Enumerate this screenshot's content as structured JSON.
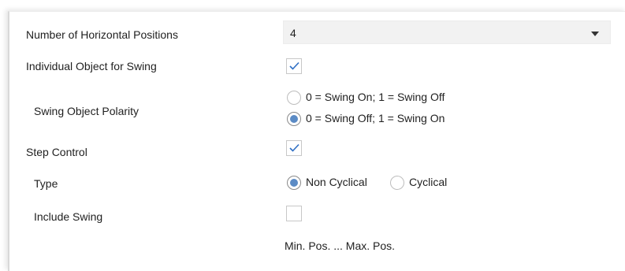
{
  "rows": {
    "horizontal_positions": {
      "label": "Number of Horizontal Positions",
      "value": "4"
    },
    "individual_swing": {
      "label": "Individual Object for Swing",
      "checked": true
    },
    "swing_polarity": {
      "label": "Swing Object Polarity",
      "options": [
        "0 = Swing On; 1 = Swing Off",
        "0 = Swing Off; 1 = Swing On"
      ],
      "selected": "0 = Swing Off; 1 = Swing On"
    },
    "step_control": {
      "label": "Step Control",
      "checked": true
    },
    "type": {
      "label": "Type",
      "options": [
        "Non Cyclical",
        "Cyclical"
      ],
      "selected": "Non Cyclical"
    },
    "include_swing": {
      "label": "Include Swing",
      "checked": false
    },
    "range_note": "Min. Pos. ... Max. Pos."
  },
  "colors": {
    "check_accent": "#2f6fc4",
    "radio_selected": "#5b8bc5",
    "dropdown_bg": "#f2f2f2"
  }
}
